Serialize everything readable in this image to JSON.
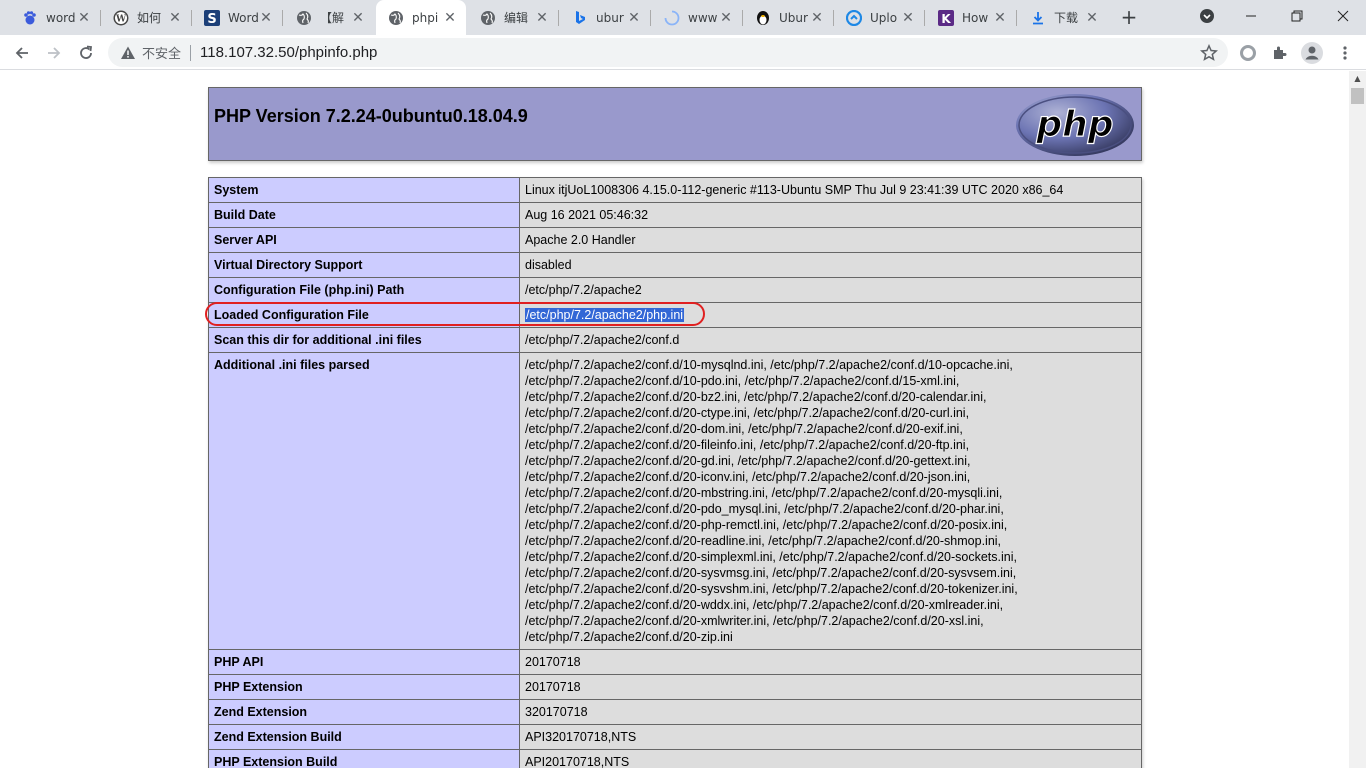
{
  "browser": {
    "tabs": [
      {
        "title": "word",
        "icon": "baidu-icon"
      },
      {
        "title": "如何",
        "icon": "wordpress-icon"
      },
      {
        "title": "Word",
        "icon": "s-icon"
      },
      {
        "title": "【解",
        "icon": "globe-icon"
      },
      {
        "title": "phpi",
        "icon": "globe-icon",
        "active": true
      },
      {
        "title": "编辑",
        "icon": "globe-icon"
      },
      {
        "title": "ubur",
        "icon": "bing-icon"
      },
      {
        "title": "www",
        "icon": "loading-icon"
      },
      {
        "title": "Ubur",
        "icon": "tux-icon"
      },
      {
        "title": "Uplo",
        "icon": "upload-icon"
      },
      {
        "title": "How",
        "icon": "k-icon"
      },
      {
        "title": "下载",
        "icon": "download-icon"
      }
    ],
    "new_tab": "+",
    "omnibox": {
      "security": "不安全",
      "url": "118.107.32.50/phpinfo.php"
    }
  },
  "phpinfo": {
    "title": "PHP Version 7.2.24-0ubuntu0.18.04.9",
    "logo_text": "php",
    "rows": [
      {
        "key": "System",
        "value": "Linux itjUoL1008306 4.15.0-112-generic #113-Ubuntu SMP Thu Jul 9 23:41:39 UTC 2020 x86_64"
      },
      {
        "key": "Build Date",
        "value": "Aug 16 2021 05:46:32"
      },
      {
        "key": "Server API",
        "value": "Apache 2.0 Handler"
      },
      {
        "key": "Virtual Directory Support",
        "value": "disabled"
      },
      {
        "key": "Configuration File (php.ini) Path",
        "value": "/etc/php/7.2/apache2"
      },
      {
        "key": "Loaded Configuration File",
        "value": "/etc/php/7.2/apache2/php.ini"
      },
      {
        "key": "Scan this dir for additional .ini files",
        "value": "/etc/php/7.2/apache2/conf.d"
      }
    ],
    "additional_ini": {
      "key": "Additional .ini files parsed",
      "lines": [
        "/etc/php/7.2/apache2/conf.d/10-mysqlnd.ini, /etc/php/7.2/apache2/conf.d/10-opcache.ini,",
        "/etc/php/7.2/apache2/conf.d/10-pdo.ini, /etc/php/7.2/apache2/conf.d/15-xml.ini,",
        "/etc/php/7.2/apache2/conf.d/20-bz2.ini, /etc/php/7.2/apache2/conf.d/20-calendar.ini,",
        "/etc/php/7.2/apache2/conf.d/20-ctype.ini, /etc/php/7.2/apache2/conf.d/20-curl.ini,",
        "/etc/php/7.2/apache2/conf.d/20-dom.ini, /etc/php/7.2/apache2/conf.d/20-exif.ini,",
        "/etc/php/7.2/apache2/conf.d/20-fileinfo.ini, /etc/php/7.2/apache2/conf.d/20-ftp.ini,",
        "/etc/php/7.2/apache2/conf.d/20-gd.ini, /etc/php/7.2/apache2/conf.d/20-gettext.ini,",
        "/etc/php/7.2/apache2/conf.d/20-iconv.ini, /etc/php/7.2/apache2/conf.d/20-json.ini,",
        "/etc/php/7.2/apache2/conf.d/20-mbstring.ini, /etc/php/7.2/apache2/conf.d/20-mysqli.ini,",
        "/etc/php/7.2/apache2/conf.d/20-pdo_mysql.ini, /etc/php/7.2/apache2/conf.d/20-phar.ini,",
        "/etc/php/7.2/apache2/conf.d/20-php-remctl.ini, /etc/php/7.2/apache2/conf.d/20-posix.ini,",
        "/etc/php/7.2/apache2/conf.d/20-readline.ini, /etc/php/7.2/apache2/conf.d/20-shmop.ini,",
        "/etc/php/7.2/apache2/conf.d/20-simplexml.ini, /etc/php/7.2/apache2/conf.d/20-sockets.ini,",
        "/etc/php/7.2/apache2/conf.d/20-sysvmsg.ini, /etc/php/7.2/apache2/conf.d/20-sysvsem.ini,",
        "/etc/php/7.2/apache2/conf.d/20-sysvshm.ini, /etc/php/7.2/apache2/conf.d/20-tokenizer.ini,",
        "/etc/php/7.2/apache2/conf.d/20-wddx.ini, /etc/php/7.2/apache2/conf.d/20-xmlreader.ini,",
        "/etc/php/7.2/apache2/conf.d/20-xmlwriter.ini, /etc/php/7.2/apache2/conf.d/20-xsl.ini,",
        "/etc/php/7.2/apache2/conf.d/20-zip.ini"
      ]
    },
    "rows_after": [
      {
        "key": "PHP API",
        "value": "20170718"
      },
      {
        "key": "PHP Extension",
        "value": "20170718"
      },
      {
        "key": "Zend Extension",
        "value": "320170718"
      },
      {
        "key": "Zend Extension Build",
        "value": "API320170718,NTS"
      },
      {
        "key": "PHP Extension Build",
        "value": "API20170718,NTS"
      }
    ]
  },
  "colors": {
    "header_bg": "#9999cc",
    "key_cell_bg": "#ccccff",
    "value_cell_bg": "#dddddd",
    "annotation_circle": "#e02020",
    "selection_highlight": "#3367d6"
  }
}
